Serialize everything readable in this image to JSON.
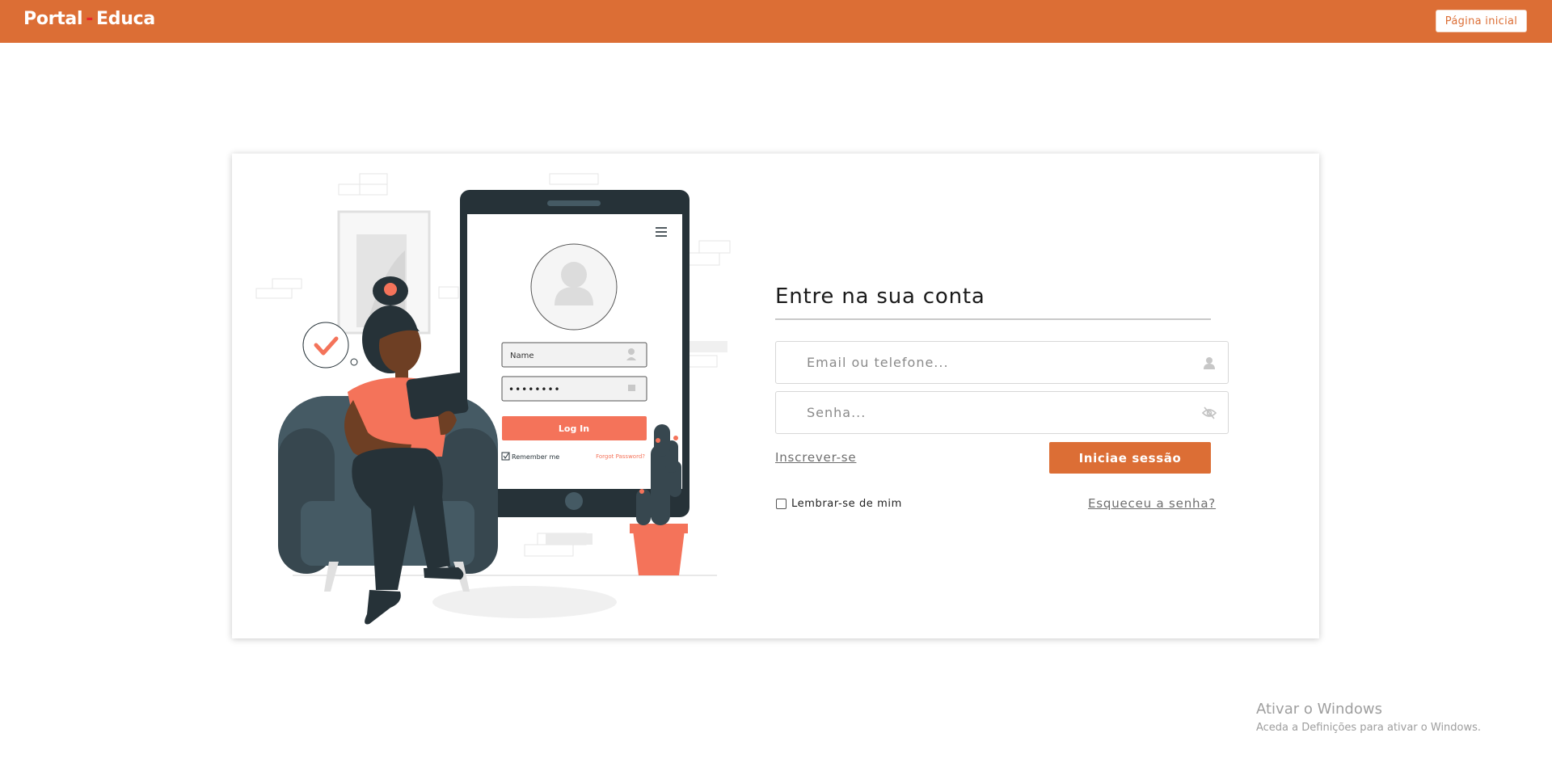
{
  "header": {
    "brand_left": "Portal",
    "brand_sep": "-",
    "brand_right": "Educa",
    "home_button": "Página inicial"
  },
  "illustration": {
    "name_field": "Name",
    "password_dots": "••••••••",
    "login_button": "Log In",
    "remember": "Remember me",
    "forgot": "Forgot Password?"
  },
  "form": {
    "title": "Entre na sua conta",
    "email_placeholder": "Email ou telefone...",
    "password_placeholder": "Senha...",
    "signup_link": "Inscrever-se",
    "submit_button": "Iniciae sessão",
    "remember_label": "Lembrar-se de mim",
    "forgot_link": "Esqueceu a senha?"
  },
  "watermark": {
    "line1": "Ativar o Windows",
    "line2": "Aceda a Definições para ativar o Windows."
  },
  "colors": {
    "accent": "#dc6e35",
    "illustration_coral": "#f4735a",
    "illustration_dark": "#263238"
  },
  "icons": {
    "email_field": "user-icon",
    "password_field": "eye-slash-icon"
  }
}
